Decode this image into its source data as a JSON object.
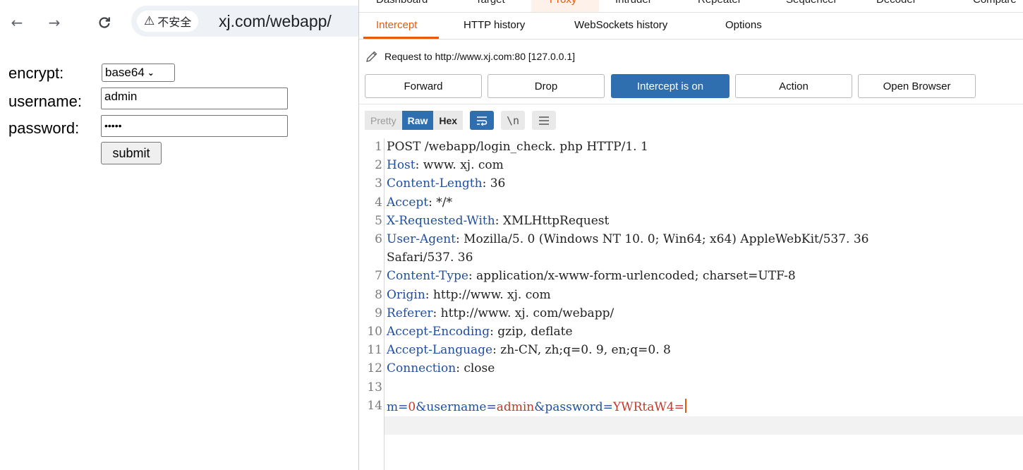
{
  "browser": {
    "security_label": "不安全",
    "url": "xj.com/webapp/",
    "form": {
      "encrypt_label": "encrypt:",
      "encrypt_value": "base64",
      "username_label": "username:",
      "username_value": "admin",
      "password_label": "password:",
      "password_mask": "•••••",
      "submit_label": "submit"
    }
  },
  "burp": {
    "main_tabs": [
      "Dashboard",
      "Target",
      "Proxy",
      "Intruder",
      "Repeater",
      "Sequencer",
      "Decoder",
      "Compare"
    ],
    "active_main_tab": "Proxy",
    "sub_tabs": [
      "Intercept",
      "HTTP history",
      "WebSockets history",
      "Options"
    ],
    "active_sub_tab": "Intercept",
    "request_to": "Request to http://www.xj.com:80  [127.0.0.1]",
    "buttons": {
      "forward": "Forward",
      "drop": "Drop",
      "intercept": "Intercept is on",
      "action": "Action",
      "open_browser": "Open Browser"
    },
    "view_modes": [
      "Pretty",
      "Raw",
      "Hex"
    ],
    "active_view": "Raw",
    "view_icons": [
      "wrap-icon",
      "newline-icon",
      "menu-icon"
    ],
    "newline_glyph": "\\n",
    "request_lines": [
      {
        "num": "1",
        "key": "",
        "sep": "",
        "value": "POST /webapp/login_check. php HTTP/1. 1"
      },
      {
        "num": "2",
        "key": "Host",
        "sep": ": ",
        "value": "www. xj. com"
      },
      {
        "num": "3",
        "key": "Content-Length",
        "sep": ": ",
        "value": "36"
      },
      {
        "num": "4",
        "key": "Accept",
        "sep": ": ",
        "value": "*/*"
      },
      {
        "num": "5",
        "key": "X-Requested-With",
        "sep": ": ",
        "value": "XMLHttpRequest"
      },
      {
        "num": "6",
        "key": "User-Agent",
        "sep": ": ",
        "value": "Mozilla/5. 0 (Windows NT 10. 0; Win64; x64) AppleWebKit/537. 36"
      },
      {
        "num": "",
        "key": "",
        "sep": "",
        "value": "Safari/537. 36"
      },
      {
        "num": "7",
        "key": "Content-Type",
        "sep": ": ",
        "value": "application/x-www-form-urlencoded; charset=UTF-8"
      },
      {
        "num": "8",
        "key": "Origin",
        "sep": ": ",
        "value": "http://www. xj. com"
      },
      {
        "num": "9",
        "key": "Referer",
        "sep": ": ",
        "value": "http://www. xj. com/webapp/"
      },
      {
        "num": "10",
        "key": "Accept-Encoding",
        "sep": ": ",
        "value": "gzip,  deflate"
      },
      {
        "num": "11",
        "key": "Accept-Language",
        "sep": ": ",
        "value": "zh-CN, zh;q=0. 9, en;q=0. 8"
      },
      {
        "num": "12",
        "key": "Connection",
        "sep": ": ",
        "value": "close"
      },
      {
        "num": "13",
        "key": "",
        "sep": "",
        "value": ""
      }
    ],
    "body_line_num": "14",
    "body_params": [
      {
        "key": "m",
        "value": "0"
      },
      {
        "key": "username",
        "value": "admin"
      },
      {
        "key": "password",
        "value": "YWRtaW4="
      }
    ],
    "colors": {
      "accent": "#e8590c",
      "selected_blue": "#2f6fb0",
      "header_key": "#1f4fa0",
      "param_value": "#c0392b"
    }
  }
}
